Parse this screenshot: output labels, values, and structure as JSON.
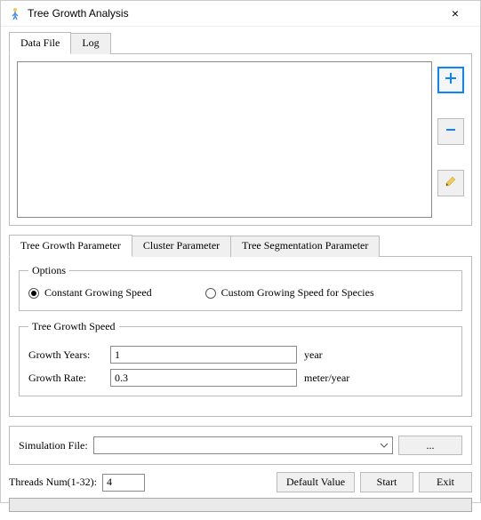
{
  "window": {
    "title": "Tree Growth Analysis",
    "close": "×"
  },
  "dataFileTabs": {
    "dataFile": "Data File",
    "log": "Log"
  },
  "paramTabs": {
    "treeGrowth": "Tree Growth Parameter",
    "cluster": "Cluster Parameter",
    "segmentation": "Tree Segmentation Parameter"
  },
  "options": {
    "legend": "Options",
    "constant": "Constant Growing Speed",
    "custom": "Custom Growing Speed for Species"
  },
  "growthSpeed": {
    "legend": "Tree Growth Speed",
    "yearsLabel": "Growth Years:",
    "yearsValue": "1",
    "yearsUnit": "year",
    "rateLabel": "Growth Rate:",
    "rateValue": "0.3",
    "rateUnit": "meter/year"
  },
  "simulation": {
    "label": "Simulation File:",
    "value": "",
    "browse": "..."
  },
  "threads": {
    "label": "Threads Num(1-32):",
    "value": "4"
  },
  "buttons": {
    "defaultValue": "Default Value",
    "start": "Start",
    "exit": "Exit"
  }
}
